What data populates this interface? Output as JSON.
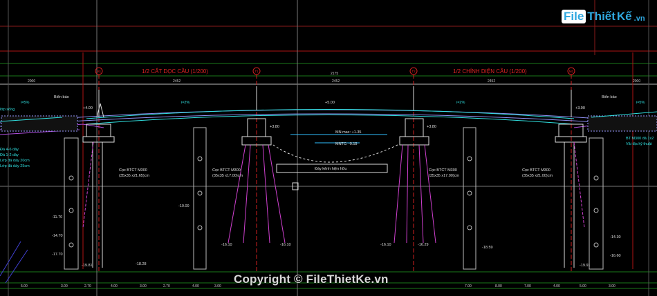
{
  "drawing": {
    "title_left": "1/2 CẮT DỌC CẦU (1/200)",
    "title_right": "1/2 CHÍNH DIỆN CẦU (1/200)",
    "axis_labels": [
      "M1",
      "T1",
      "T2",
      "M2"
    ],
    "top_dims": [
      "2000",
      "2452",
      "2452",
      "2452",
      "2452",
      "2000"
    ],
    "mid_dim": "2175",
    "notes": {
      "bien_bao_left": "Biển báo",
      "bien_bao_right": "Biển báo",
      "mnmax": "MN max: +1.35",
      "mntc": "MNTC: -0.15",
      "day_kenh": "Đáy kênh hiện hữu",
      "pile_left": "Cọc BTCT M300",
      "pile_left_size": "(35x35 x21.65)cm",
      "pile_t1": "Cọc BTCT M300",
      "pile_t1_size": "(35x35 x17.00)cm",
      "pile_t2": "Cọc BTCT M300",
      "pile_t2_size": "(35x35 x17.00)cm",
      "pile_right": "Cọc BTCT M300",
      "pile_right_size": "(35x35 x21.00)cm",
      "slope_left": "i=5%",
      "slope_mid_left": "i=2%",
      "slope_mid_right": "i=2%",
      "slope_right": "i=5%",
      "left_text_1": "lớp sống",
      "left_text_2": "Đá 4-6 dày",
      "left_text_3": "Đá 1-2 dày",
      "left_text_4": "Lớp đá dày 20cm",
      "left_text_5": "Lớp đá dày 25cm",
      "right_text_1": "BT M300 đá 1x2",
      "right_text_2": "Vải địa kỹ thuật",
      "el_center": "+5.00",
      "el_left_deck": "+4.00",
      "el_right_deck": "+3.90",
      "el_pier1": "+3.80",
      "el_pier2": "+3.80"
    },
    "elevations_left": [
      "-11.70",
      "-14.70",
      "-17.70"
    ],
    "elevations_right": [
      "-10.00",
      "-14.30",
      "-16.60"
    ],
    "pile_tips": [
      "-19.81",
      "-18.28",
      "-16.10",
      "-16.10",
      "-16.10",
      "-16.29",
      "-18.59",
      "-19.91"
    ],
    "bottom_dims": [
      "5.00",
      "3.00",
      "2.70",
      "4.00",
      "3.00",
      "2.70",
      "4.00",
      "3.00",
      "7.00",
      "8.00",
      "7.00",
      "4.00",
      "5.00",
      "3.00"
    ]
  },
  "watermark": {
    "logo_file": "File",
    "logo_thiet": "Thiết",
    "logo_ke": "Kế",
    "logo_vn": ".vn",
    "copyright": "Copyright © FileThietKe.vn"
  }
}
